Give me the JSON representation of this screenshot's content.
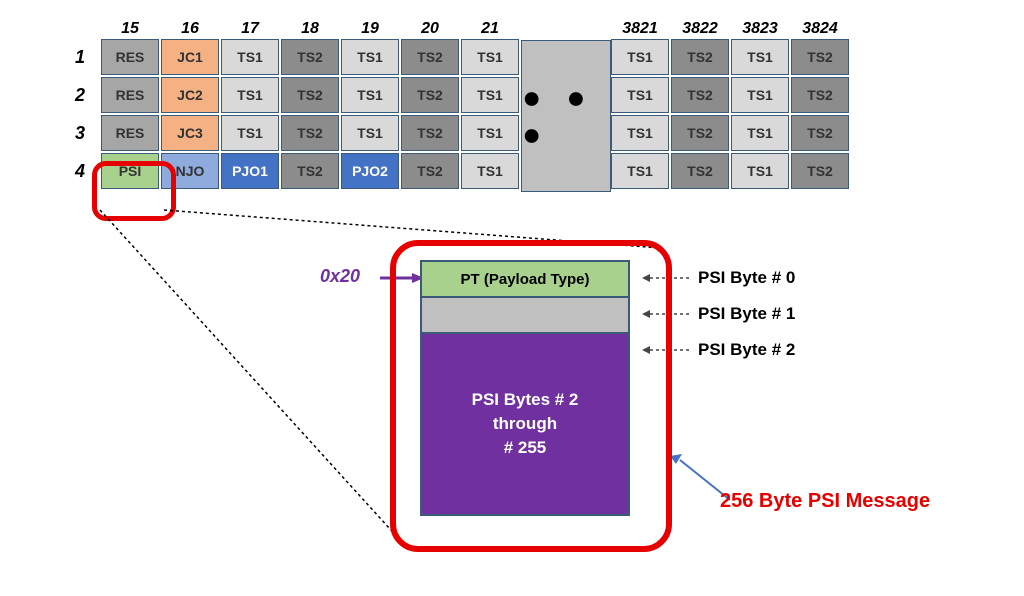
{
  "columns_left": [
    "15",
    "16",
    "17",
    "18",
    "19",
    "20",
    "21"
  ],
  "columns_right": [
    "3821",
    "3822",
    "3823",
    "3824"
  ],
  "row_labels": [
    "1",
    "2",
    "3",
    "4"
  ],
  "grid": {
    "rows_left": [
      [
        "RES",
        "JC1",
        "TS1",
        "TS2",
        "TS1",
        "TS2",
        "TS1"
      ],
      [
        "RES",
        "JC2",
        "TS1",
        "TS2",
        "TS1",
        "TS2",
        "TS1"
      ],
      [
        "RES",
        "JC3",
        "TS1",
        "TS2",
        "TS1",
        "TS2",
        "TS1"
      ],
      [
        "PSI",
        "NJO",
        "PJO1",
        "TS2",
        "PJO2",
        "TS2",
        "TS1"
      ]
    ],
    "rows_right": [
      [
        "TS1",
        "TS2",
        "TS1",
        "TS2"
      ],
      [
        "TS1",
        "TS2",
        "TS1",
        "TS2"
      ],
      [
        "TS1",
        "TS2",
        "TS1",
        "TS2"
      ],
      [
        "TS1",
        "TS2",
        "TS1",
        "TS2"
      ]
    ]
  },
  "gap_dots": "● ● ●",
  "psi_detail": {
    "hex_value": "0x20",
    "pt_label": "PT (Payload Type)",
    "rest_line1": "PSI Bytes # 2",
    "rest_line2": "through",
    "rest_line3": "# 255",
    "side_label0": "PSI Byte # 0",
    "side_label1": "PSI Byte # 1",
    "side_label2": "PSI Byte # 2",
    "msg_label": "256 Byte PSI Message"
  },
  "cell_styles": {
    "RES": "c-gray",
    "JC1": "c-orange",
    "JC2": "c-orange",
    "JC3": "c-orange",
    "TS1": "c-lgray",
    "TS2": "c-dgray",
    "PSI": "c-green",
    "NJO": "c-lblue",
    "PJO1": "c-blue",
    "PJO2": "c-blue"
  }
}
